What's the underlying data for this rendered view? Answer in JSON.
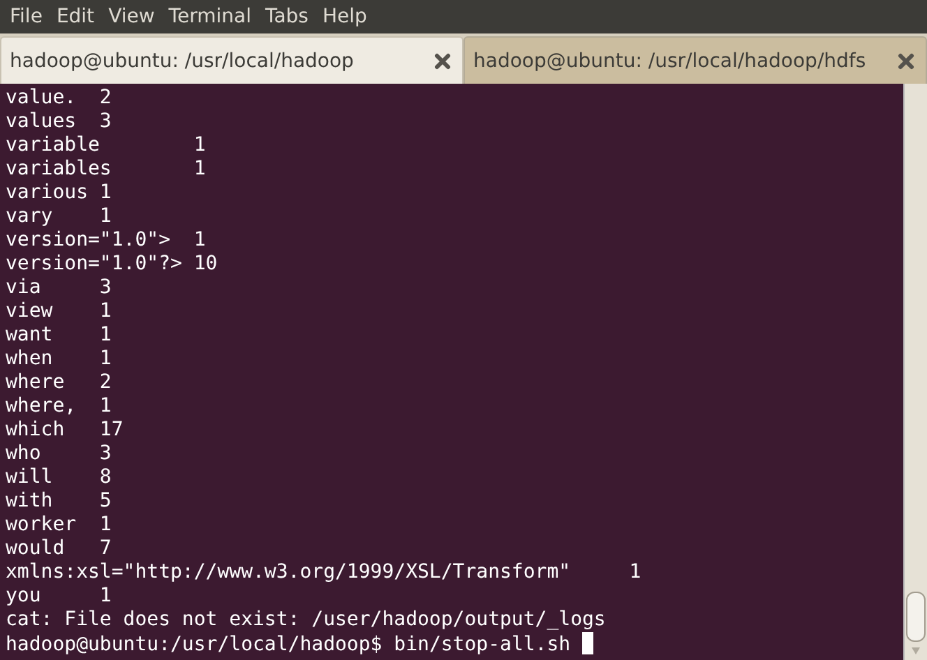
{
  "menu": [
    "File",
    "Edit",
    "View",
    "Terminal",
    "Tabs",
    "Help"
  ],
  "tabs": [
    {
      "label": "hadoop@ubuntu: /usr/local/hadoop",
      "selected": true
    },
    {
      "label": "hadoop@ubuntu: /usr/local/hadoop/hdfs",
      "selected": false
    }
  ],
  "output_lines": [
    "value.  2",
    "values  3",
    "variable        1",
    "variables       1",
    "various 1",
    "vary    1",
    "version=\"1.0\">  1",
    "version=\"1.0\"?> 10",
    "via     3",
    "view    1",
    "want    1",
    "when    1",
    "where   2",
    "where,  1",
    "which   17",
    "who     3",
    "will    8",
    "with    5",
    "worker  1",
    "would   7",
    "xmlns:xsl=\"http://www.w3.org/1999/XSL/Transform\"     1",
    "you     1",
    "cat: File does not exist: /user/hadoop/output/_logs"
  ],
  "prompt": {
    "text": "hadoop@ubuntu:/usr/local/hadoop$",
    "command": "bin/stop-all.sh"
  }
}
